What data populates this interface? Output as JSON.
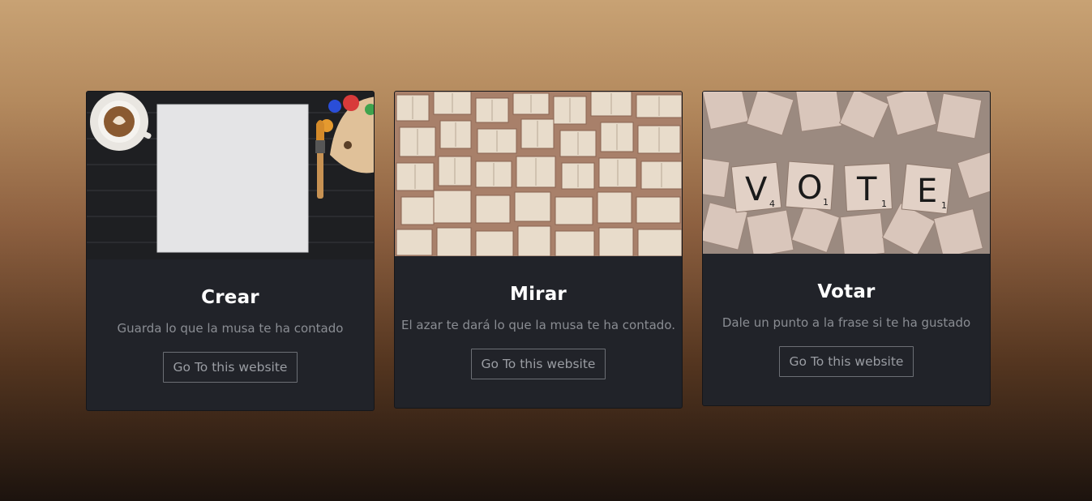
{
  "cards": [
    {
      "title": "Crear",
      "text": "Guarda lo que la musa te ha contado",
      "button_label": "Go To this website"
    },
    {
      "title": "Mirar",
      "text": "El azar te dará lo que la musa te ha contado.",
      "button_label": "Go To this website"
    },
    {
      "title": "Votar",
      "text": "Dale un punto a la frase si te ha gustado",
      "button_label": "Go To this website"
    }
  ],
  "vote_tiles": [
    {
      "letter": "V",
      "points": "4"
    },
    {
      "letter": "O",
      "points": "1"
    },
    {
      "letter": "T",
      "points": "1"
    },
    {
      "letter": "E",
      "points": "1"
    }
  ],
  "colors": {
    "card_bg": "#212329",
    "button_border": "#6c6f75",
    "gradient_top": "#c8a274",
    "gradient_bottom": "#1c130e"
  }
}
